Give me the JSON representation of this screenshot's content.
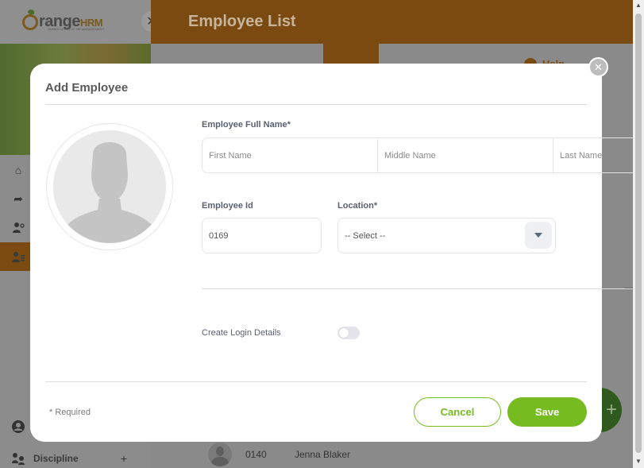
{
  "app": {
    "logo_main": "range",
    "logo_suffix": "HRM",
    "logo_tagline": "HUMAN LEVEL OF HR MANAGEMENT",
    "page_title": "Employee List",
    "help_label": "Help"
  },
  "sidebar": {
    "items": [
      {
        "icon": "home-icon",
        "label": ""
      },
      {
        "icon": "share-icon",
        "label": ""
      },
      {
        "icon": "user-settings-icon",
        "label": ""
      },
      {
        "icon": "employee-list-icon",
        "label": ""
      },
      {
        "icon": "profile-icon",
        "label": ""
      },
      {
        "icon": "discipline-icon",
        "label": "Discipline"
      }
    ]
  },
  "background_list": {
    "row": {
      "id": "0140",
      "name": "Jenna Blaker"
    }
  },
  "modal": {
    "title": "Add Employee",
    "full_name_label": "Employee Full Name*",
    "first_name_placeholder": "First Name",
    "middle_name_placeholder": "Middle Name",
    "last_name_placeholder": "Last Name",
    "employee_id_label": "Employee Id",
    "employee_id_value": "0169",
    "location_label": "Location*",
    "location_value": "-- Select --",
    "create_login_label": "Create Login Details",
    "create_login_enabled": false,
    "required_note": "* Required",
    "cancel_label": "Cancel",
    "save_label": "Save"
  },
  "colors": {
    "accent_green": "#76bc21",
    "brand_orange": "#f28c1a"
  }
}
